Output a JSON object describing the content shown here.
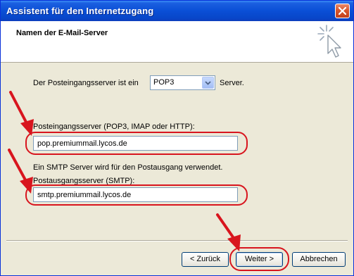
{
  "window": {
    "title": "Assistent für den Internetzugang",
    "close_icon": "close-icon"
  },
  "header": {
    "heading": "Namen der E-Mail-Server",
    "icon": "wizard-sparkle-cursor-icon"
  },
  "form": {
    "incoming_type_prefix": "Der Posteingangsserver ist ein",
    "incoming_type_value": "POP3",
    "incoming_type_suffix": "Server.",
    "incoming_label": "Posteingangsserver (POP3, IMAP oder HTTP):",
    "incoming_value": "pop.premiummail.lycos.de",
    "smtp_info": "Ein SMTP Server wird für den Postausgang verwendet.",
    "outgoing_label": "Postausgangsserver (SMTP):",
    "outgoing_value": "smtp.premiummail.lycos.de"
  },
  "buttons": {
    "back": "< Zurück",
    "next": "Weiter >",
    "cancel": "Abbrechen"
  },
  "annotations": {
    "color": "#d8151e",
    "arrow_icon": "red-arrow-icon"
  }
}
